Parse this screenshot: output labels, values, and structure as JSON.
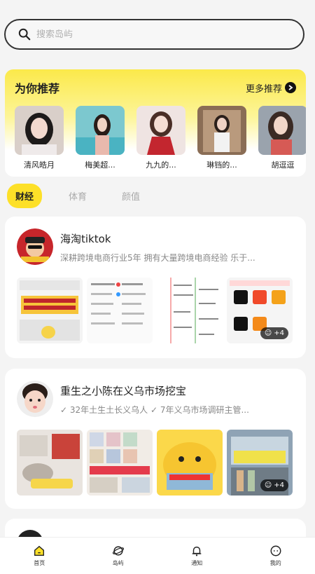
{
  "search": {
    "placeholder": "搜索岛屿"
  },
  "recommend": {
    "title": "为你推荐",
    "more": "更多推荐",
    "items": [
      {
        "name": "清风皓月"
      },
      {
        "name": "梅美超..."
      },
      {
        "name": "九九的..."
      },
      {
        "name": "琳铛的..."
      },
      {
        "name": "胡逗逗"
      }
    ]
  },
  "tabs": [
    {
      "label": "财经",
      "active": true
    },
    {
      "label": "体育",
      "active": false
    },
    {
      "label": "颜值",
      "active": false
    }
  ],
  "posts": [
    {
      "name": "海淘tiktok",
      "desc": "深耕跨境电商行业5年 拥有大量跨境电商经验 乐于...",
      "more_count": "+4"
    },
    {
      "name": "重生之小陈在义乌市场挖宝",
      "desc": "✓ 32年土生土长义乌人 ✓ 7年义乌市场调研主管...",
      "more_count": "+4"
    }
  ],
  "tabbar": [
    {
      "label": "首页",
      "icon": "home-icon"
    },
    {
      "label": "岛屿",
      "icon": "island-icon"
    },
    {
      "label": "通知",
      "icon": "bell-icon"
    },
    {
      "label": "我的",
      "icon": "profile-icon"
    }
  ],
  "colors": {
    "accent": "#fde028",
    "background": "#f4f4f4"
  }
}
